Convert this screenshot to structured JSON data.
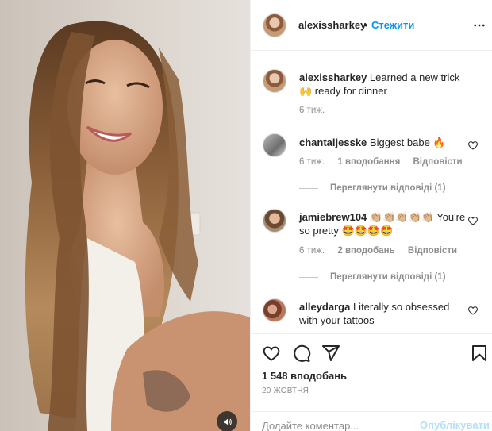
{
  "post": {
    "author": "alexissharkey",
    "follow_label": "Стежити",
    "dot": "•",
    "caption_user": "alexissharkey",
    "caption_text": "Learned a new trick🙌 ready for dinner",
    "caption_time": "6 тиж.",
    "likes": "1 548 вподобань",
    "date": "20 ЖОВТНЯ"
  },
  "comments": [
    {
      "user": "chantaljesske",
      "text": "Biggest babe 🔥",
      "time": "6 тиж.",
      "likes": "1 вподобання",
      "reply_label": "Відповісти",
      "view_replies": "Переглянути відповіді (1)"
    },
    {
      "user": "jamiebrew104",
      "text": "👏🏼👏🏼👏🏼👏🏼👏🏼 You're so pretty 🤩🤩🤩🤩",
      "time": "6 тиж.",
      "likes": "2 вподобань",
      "reply_label": "Відповісти",
      "view_replies": "Переглянути відповіді (1)"
    },
    {
      "user": "alleydarga",
      "text": "Literally so obsessed with your tattoos"
    }
  ],
  "composer": {
    "placeholder": "Додайте коментар...",
    "post_label": "Опублікувати"
  },
  "icons": {
    "more": "more-horizontal-icon",
    "like": "heart-icon",
    "comment": "comment-icon",
    "share": "paper-plane-icon",
    "save": "bookmark-icon",
    "sound": "speaker-icon"
  },
  "colors": {
    "link_blue": "#0095f6",
    "post_disabled": "#b2dffc",
    "muted_text": "#8e8e8e",
    "divider": "#efefef"
  }
}
